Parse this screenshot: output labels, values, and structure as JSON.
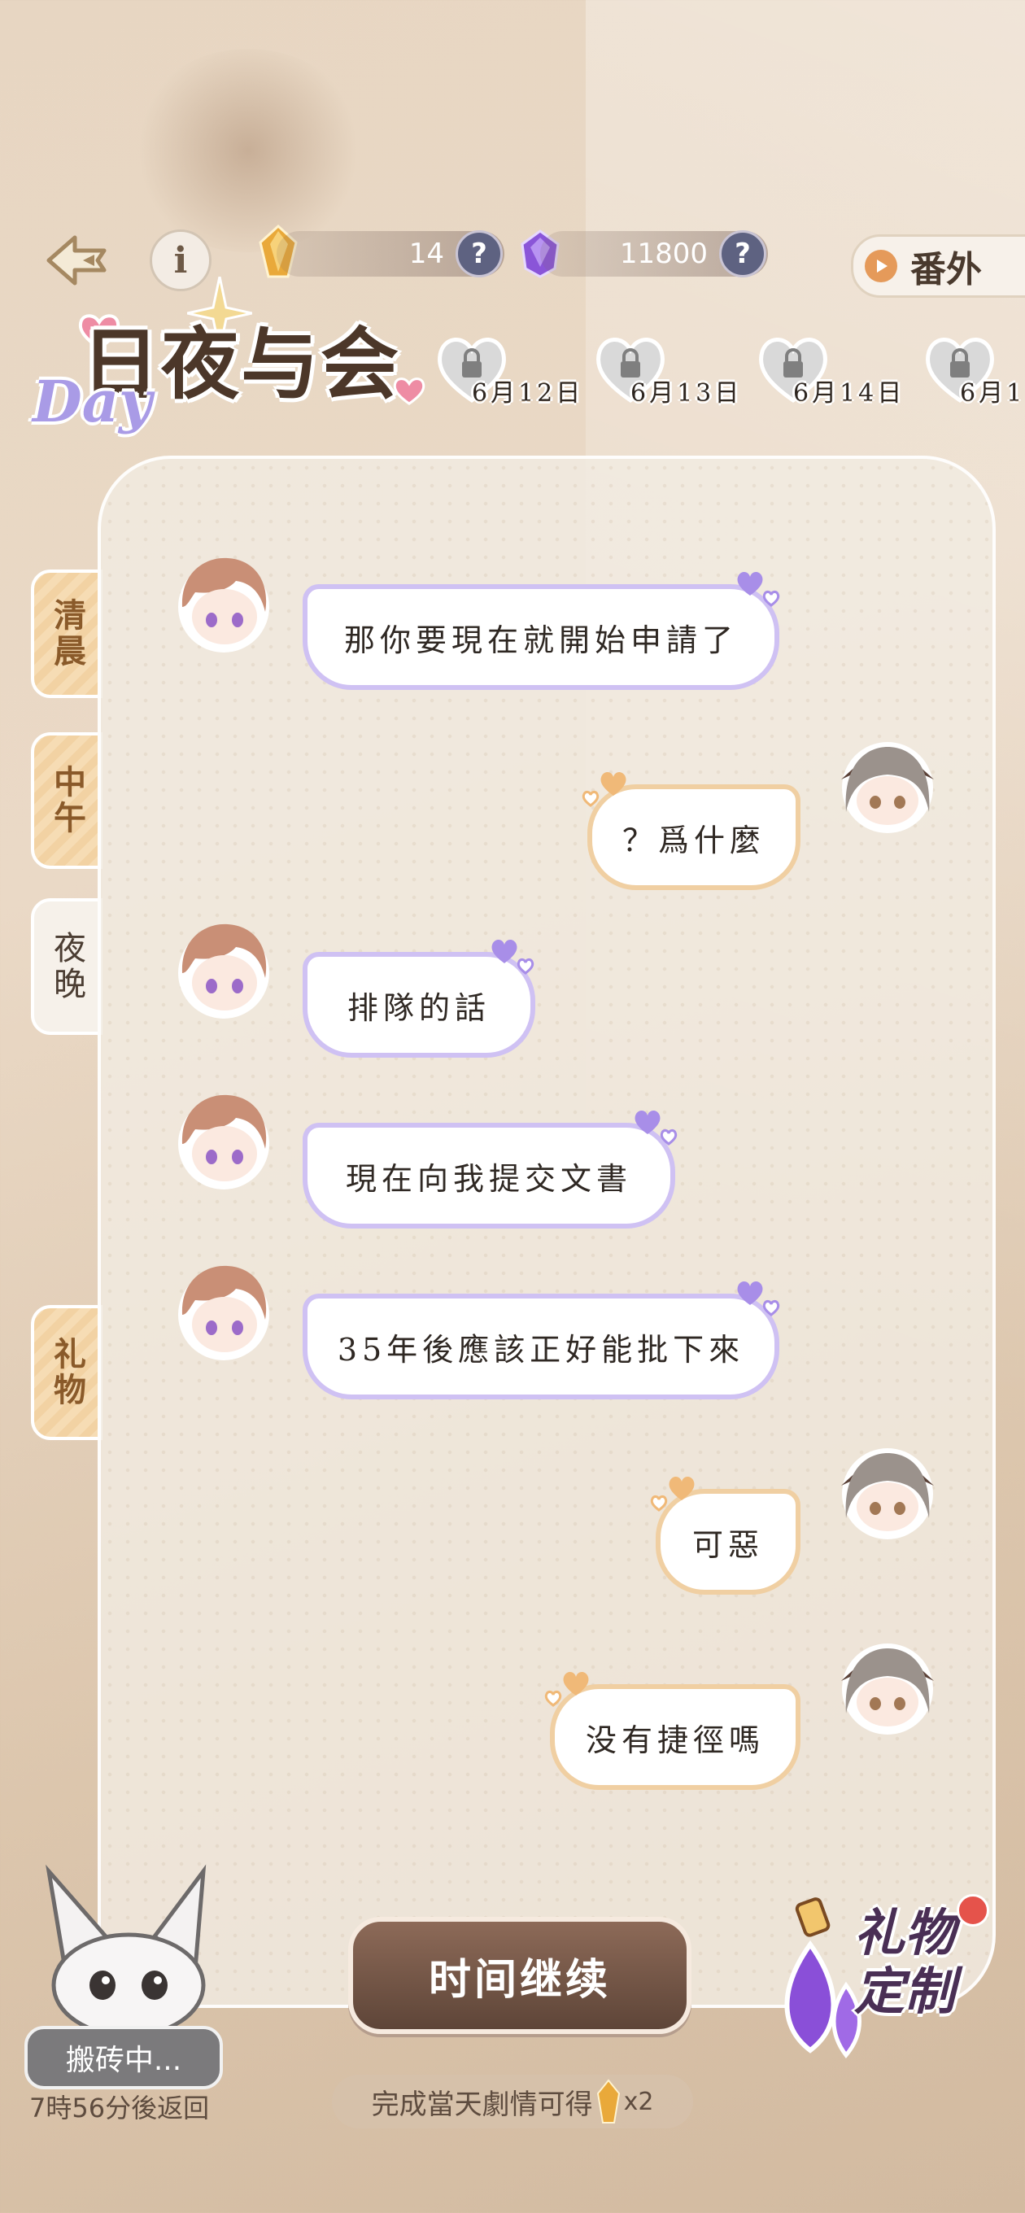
{
  "header": {
    "amber_count": "14",
    "gem_count": "11800",
    "help_symbol": "?",
    "info_symbol": "i",
    "extra_label": "番外"
  },
  "logo": {
    "title": "日夜与会",
    "day": "Day"
  },
  "dates": [
    "6月12日",
    "6月13日",
    "6月14日",
    "6月1"
  ],
  "side_tabs": [
    "清晨",
    "中午",
    "夜晚",
    "礼物"
  ],
  "messages": [
    {
      "side": "left",
      "text": "那你要現在就開始申請了"
    },
    {
      "side": "right",
      "text": "？爲什麼"
    },
    {
      "side": "left",
      "text": "排隊的話"
    },
    {
      "side": "left",
      "text": "現在向我提交文書"
    },
    {
      "side": "left",
      "text": "35年後應該正好能批下來"
    },
    {
      "side": "right",
      "text": "可惡"
    },
    {
      "side": "right",
      "text": "没有捷徑嗎"
    }
  ],
  "bottom": {
    "continue_label": "时间继续",
    "reward_text": "完成當天劇情可得",
    "reward_count": "x2",
    "pet_status": "搬砖中...",
    "pet_return": "7時56分後返回",
    "gift_custom": "礼物定制"
  },
  "colors": {
    "left_bubble_border": "#cfc1f3",
    "right_bubble_border": "#f0cfa2",
    "button": "#6e5244"
  }
}
